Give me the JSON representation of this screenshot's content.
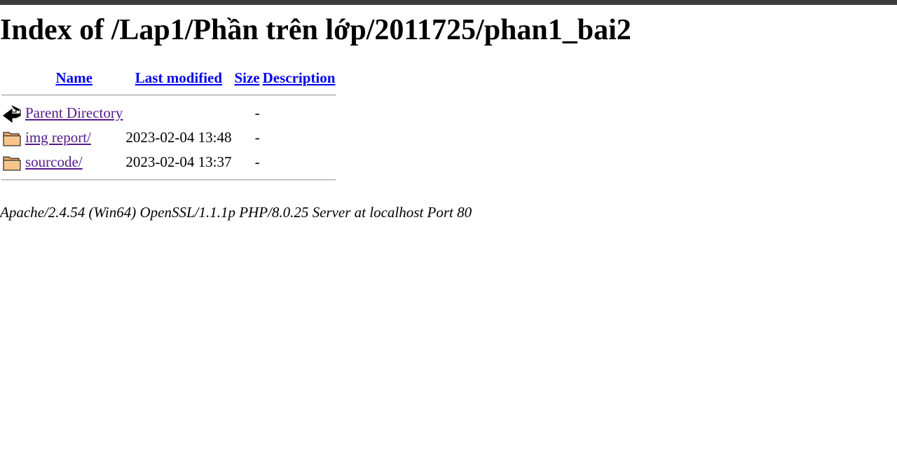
{
  "page": {
    "title": "Index of /Lap1/Phần trên lớp/2011725/phan1_bai2"
  },
  "table": {
    "headers": {
      "name": "Name",
      "last_modified": "Last modified",
      "size": "Size",
      "description": "Description"
    },
    "rows": [
      {
        "icon": "back-arrow-icon",
        "name": "Parent Directory",
        "last_modified": "",
        "size": "-",
        "description": ""
      },
      {
        "icon": "folder-icon",
        "name": "img report/",
        "last_modified": "2023-02-04 13:48",
        "size": "-",
        "description": ""
      },
      {
        "icon": "folder-icon",
        "name": "sourcode/",
        "last_modified": "2023-02-04 13:37",
        "size": "-",
        "description": ""
      }
    ]
  },
  "footer": {
    "address": "Apache/2.4.54 (Win64) OpenSSL/1.1.1p PHP/8.0.25 Server at localhost Port 80"
  }
}
